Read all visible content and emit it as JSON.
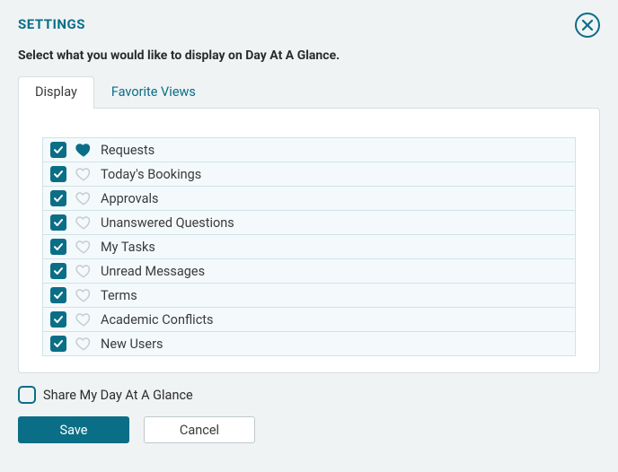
{
  "title": "SETTINGS",
  "subtitle": "Select what you would like to display on Day At A Glance.",
  "tabs": [
    {
      "label": "Display",
      "active": true
    },
    {
      "label": "Favorite Views",
      "active": false
    }
  ],
  "items": [
    {
      "label": "Requests",
      "checked": true,
      "favorited": true
    },
    {
      "label": "Today's Bookings",
      "checked": true,
      "favorited": false
    },
    {
      "label": "Approvals",
      "checked": true,
      "favorited": false
    },
    {
      "label": "Unanswered Questions",
      "checked": true,
      "favorited": false
    },
    {
      "label": "My Tasks",
      "checked": true,
      "favorited": false
    },
    {
      "label": "Unread Messages",
      "checked": true,
      "favorited": false
    },
    {
      "label": "Terms",
      "checked": true,
      "favorited": false
    },
    {
      "label": "Academic Conflicts",
      "checked": true,
      "favorited": false
    },
    {
      "label": "New Users",
      "checked": true,
      "favorited": false
    }
  ],
  "share": {
    "label": "Share My Day At A Glance",
    "checked": false
  },
  "buttons": {
    "save": "Save",
    "cancel": "Cancel"
  },
  "colors": {
    "accent": "#0b6e87",
    "panel": "#ffffff",
    "rowbg": "#f4fafc"
  }
}
